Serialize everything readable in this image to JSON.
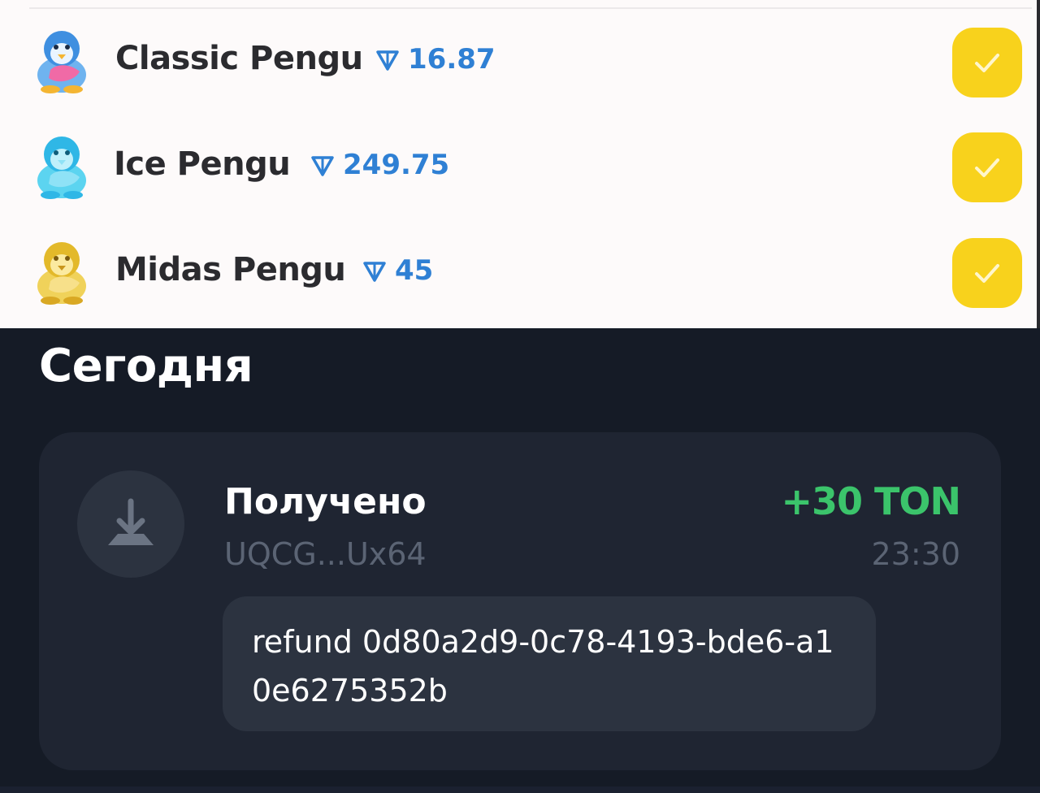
{
  "gifts": [
    {
      "name": "Classic Pengu",
      "price": "16.87",
      "selected": true,
      "icon": "classic-pengu-sticker",
      "color": "#4aa3e8"
    },
    {
      "name": "Ice Pengu",
      "price": "249.75",
      "selected": true,
      "icon": "ice-pengu-sticker",
      "color": "#36c6e8"
    },
    {
      "name": "Midas Pengu",
      "price": "45",
      "selected": true,
      "icon": "midas-pengu-sticker",
      "color": "#e8c23a"
    }
  ],
  "currency_icon": "ton-diamond-icon",
  "history": {
    "section_title": "Сегодня",
    "transaction": {
      "type_label": "Получено",
      "address": "UQCG...Ux64",
      "amount": "+30 TON",
      "time": "23:30",
      "comment": "refund 0d80a2d9-0c78-4193-bde6-a10e6275352b",
      "icon": "arrow-down-icon"
    }
  },
  "colors": {
    "accent_blue": "#2f80d4",
    "check_yellow": "#f8d21c",
    "amount_green": "#3bc46b",
    "dark_bg": "#151b26",
    "card_bg": "#1f2532"
  }
}
